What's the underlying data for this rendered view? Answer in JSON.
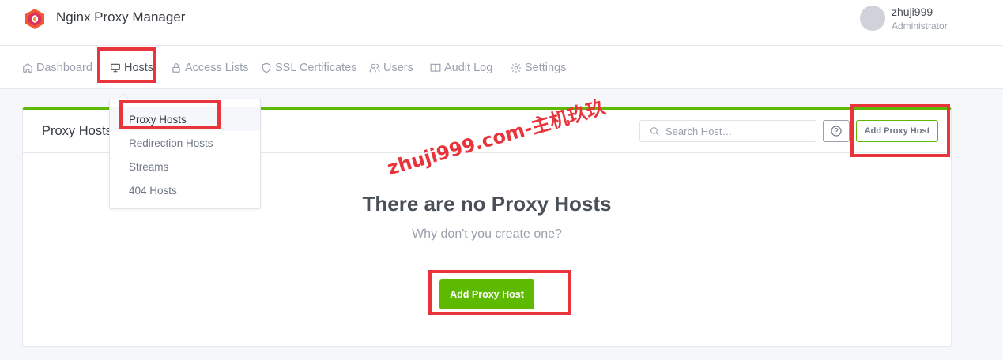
{
  "header": {
    "title": "Nginx Proxy Manager",
    "user_name": "zhuji999",
    "user_role": "Administrator"
  },
  "nav": [
    {
      "label": "Dashboard",
      "icon": "home-icon"
    },
    {
      "label": "Hosts",
      "icon": "monitor-icon",
      "active": true
    },
    {
      "label": "Access Lists",
      "icon": "lock-icon"
    },
    {
      "label": "SSL Certificates",
      "icon": "shield-icon"
    },
    {
      "label": "Users",
      "icon": "users-icon"
    },
    {
      "label": "Audit Log",
      "icon": "book-icon"
    },
    {
      "label": "Settings",
      "icon": "gear-icon"
    }
  ],
  "hosts_menu": [
    {
      "label": "Proxy Hosts",
      "active": true
    },
    {
      "label": "Redirection Hosts"
    },
    {
      "label": "Streams"
    },
    {
      "label": "404 Hosts"
    }
  ],
  "card": {
    "title": "Proxy Hosts",
    "search_placeholder": "Search Host…",
    "add_button": "Add Proxy Host",
    "empty_title": "There are no Proxy Hosts",
    "empty_subtitle": "Why don't you create one?",
    "empty_add_button": "Add Proxy Host"
  },
  "watermark": "zhuji999.com-主机玖玖",
  "colors": {
    "accent": "#5eba00",
    "highlight": "#e8343a"
  }
}
